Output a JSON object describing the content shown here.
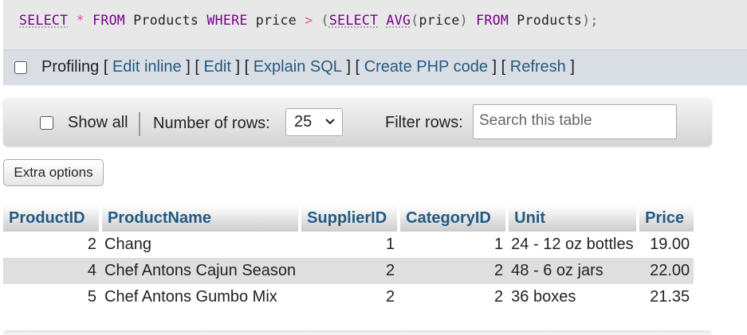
{
  "sql": {
    "tokens": [
      {
        "text": "SELECT",
        "cls": "kw"
      },
      {
        "text": " ",
        "cls": "ident"
      },
      {
        "text": "*",
        "cls": "op"
      },
      {
        "text": " ",
        "cls": "ident"
      },
      {
        "text": "FROM",
        "cls": "kw-plain"
      },
      {
        "text": " Products ",
        "cls": "ident"
      },
      {
        "text": "WHERE",
        "cls": "kw-plain"
      },
      {
        "text": " price ",
        "cls": "ident"
      },
      {
        "text": ">",
        "cls": "op"
      },
      {
        "text": " ",
        "cls": "ident"
      },
      {
        "text": "(",
        "cls": "punct"
      },
      {
        "text": "SELECT",
        "cls": "kw"
      },
      {
        "text": " ",
        "cls": "ident"
      },
      {
        "text": "AVG",
        "cls": "fn"
      },
      {
        "text": "(",
        "cls": "punct"
      },
      {
        "text": "price",
        "cls": "ident"
      },
      {
        "text": ")",
        "cls": "punct"
      },
      {
        "text": " ",
        "cls": "ident"
      },
      {
        "text": "FROM",
        "cls": "kw-plain"
      },
      {
        "text": " Products",
        "cls": "ident"
      },
      {
        "text": ")",
        "cls": "punct"
      },
      {
        "text": ";",
        "cls": "punct"
      }
    ]
  },
  "profiling": {
    "label": "Profiling",
    "links": [
      "Edit inline",
      "Edit",
      "Explain SQL",
      "Create PHP code",
      "Refresh"
    ]
  },
  "nav": {
    "show_all_label": "Show all",
    "rows_label": "Number of rows:",
    "rows_value": "25",
    "filter_label": "Filter rows:",
    "filter_placeholder": "Search this table"
  },
  "extra_options_label": "Extra options",
  "colors": {
    "link": "#235a81",
    "keyword": "#770088",
    "operator": "#e0509e"
  },
  "table": {
    "columns": [
      "ProductID",
      "ProductName",
      "SupplierID",
      "CategoryID",
      "Unit",
      "Price"
    ],
    "rows": [
      [
        "2",
        "Chang",
        "1",
        "1",
        "24 - 12 oz bottles",
        "19.00"
      ],
      [
        "4",
        "Chef Antons Cajun Season",
        "2",
        "2",
        "48 - 6 oz jars",
        "22.00"
      ],
      [
        "5",
        "Chef Antons Gumbo Mix",
        "2",
        "2",
        "36 boxes",
        "21.35"
      ]
    ]
  }
}
